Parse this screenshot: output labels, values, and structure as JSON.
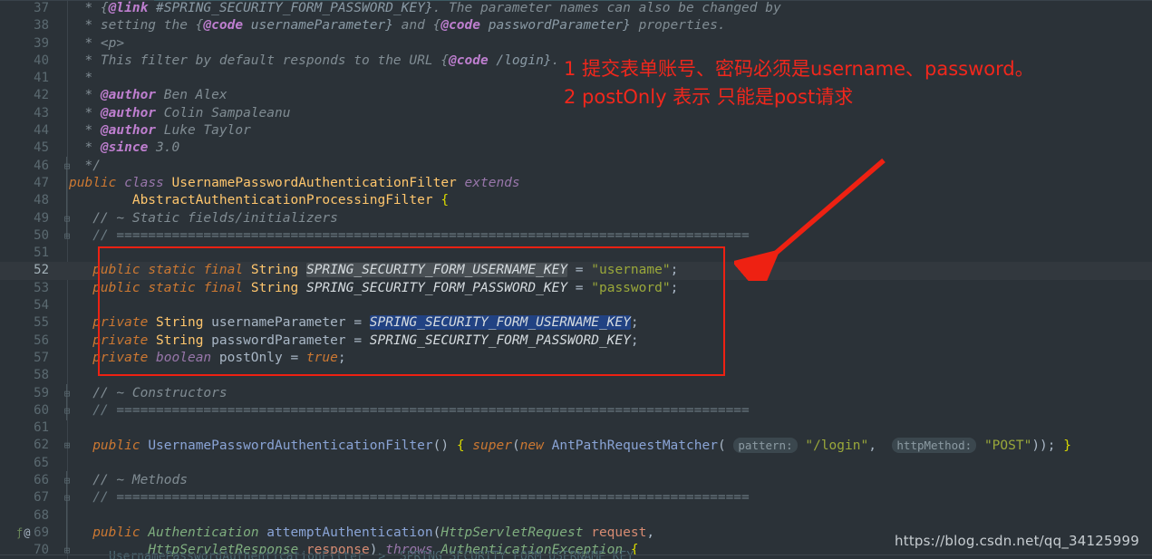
{
  "editor": {
    "theme": "darcula",
    "background": "#2b3238",
    "current_line": 52,
    "watermark": "https://blog.csdn.net/qq_34125999",
    "breadcrumb": "UsernamePasswordAuthenticationFilter  >  SPRING_SECURITY_FORM_USERNAME_KEY"
  },
  "colors": {
    "annotation_red": "#f1271c",
    "box_red": "#ee2112",
    "keyword": "#cc7832",
    "keyword2": "#9876aa",
    "type": "#ffc66d",
    "string": "#9aa83a",
    "comment": "#808c93",
    "javadoc_tag": "#bf7fd0",
    "method": "#8aa4d6",
    "selection_grey": "#4a5055",
    "selection_blue": "#214283"
  },
  "annotations": {
    "note_1": "1 提交表单账号、密码必须是username、password。",
    "note_2": "2 postOnly 表示 只能是post请求"
  },
  "lines": [
    {
      "n": "37",
      "fold": "",
      "marks": ""
    },
    {
      "n": "38",
      "fold": "",
      "marks": ""
    },
    {
      "n": "39",
      "fold": "",
      "marks": ""
    },
    {
      "n": "40",
      "fold": "",
      "marks": ""
    },
    {
      "n": "41",
      "fold": "",
      "marks": ""
    },
    {
      "n": "42",
      "fold": "",
      "marks": ""
    },
    {
      "n": "43",
      "fold": "",
      "marks": ""
    },
    {
      "n": "44",
      "fold": "",
      "marks": ""
    },
    {
      "n": "45",
      "fold": "",
      "marks": ""
    },
    {
      "n": "46",
      "fold": "⊟",
      "marks": ""
    },
    {
      "n": "47",
      "fold": "",
      "marks": ""
    },
    {
      "n": "48",
      "fold": "",
      "marks": ""
    },
    {
      "n": "49",
      "fold": "⊟",
      "marks": ""
    },
    {
      "n": "50",
      "fold": "⊟",
      "marks": ""
    },
    {
      "n": "51",
      "fold": "",
      "marks": ""
    },
    {
      "n": "52",
      "fold": "",
      "marks": ""
    },
    {
      "n": "53",
      "fold": "",
      "marks": ""
    },
    {
      "n": "54",
      "fold": "",
      "marks": ""
    },
    {
      "n": "55",
      "fold": "",
      "marks": ""
    },
    {
      "n": "56",
      "fold": "",
      "marks": ""
    },
    {
      "n": "57",
      "fold": "",
      "marks": ""
    },
    {
      "n": "58",
      "fold": "",
      "marks": ""
    },
    {
      "n": "59",
      "fold": "⊟",
      "marks": ""
    },
    {
      "n": "60",
      "fold": "⊟",
      "marks": ""
    },
    {
      "n": "61",
      "fold": "",
      "marks": ""
    },
    {
      "n": "62",
      "fold": "⊞",
      "marks": ""
    },
    {
      "n": "65",
      "fold": "",
      "marks": ""
    },
    {
      "n": "66",
      "fold": "⊟",
      "marks": ""
    },
    {
      "n": "67",
      "fold": "⊟",
      "marks": ""
    },
    {
      "n": "68",
      "fold": "",
      "marks": ""
    },
    {
      "n": "69",
      "fold": "",
      "marks": "ƒ @"
    },
    {
      "n": "70",
      "fold": "⊟",
      "marks": ""
    }
  ],
  "code_text": {
    "l37": "  * {@link #SPRING_SECURITY_FORM_PASSWORD_KEY}. The parameter names can also be changed by",
    "l38": "  * setting the {@code usernameParameter} and {@code passwordParameter} properties.",
    "l39": "  * <p>",
    "l40": "  * This filter by default responds to the URL {@code /login}.",
    "l41": "  *",
    "l42": "  * @author Ben Alex",
    "l43": "  * @author Colin Sampaleanu",
    "l44": "  * @author Luke Taylor",
    "l45": "  * @since 3.0",
    "l46": "  */",
    "l47": "public class UsernamePasswordAuthenticationFilter extends",
    "l48": "         AbstractAuthenticationProcessingFilter {",
    "l49": "   // ~ Static fields/initializers",
    "l50": "   // ================================================================================",
    "l51": "",
    "l52": "   public static final String SPRING_SECURITY_FORM_USERNAME_KEY = \"username\";",
    "l53": "   public static final String SPRING_SECURITY_FORM_PASSWORD_KEY = \"password\";",
    "l54": "",
    "l55": "   private String usernameParameter = SPRING_SECURITY_FORM_USERNAME_KEY;",
    "l56": "   private String passwordParameter = SPRING_SECURITY_FORM_PASSWORD_KEY;",
    "l57": "   private boolean postOnly = true;",
    "l58": "",
    "l59": "   // ~ Constructors",
    "l60": "   // ================================================================================",
    "l61": "",
    "l62": "   public UsernamePasswordAuthenticationFilter() { super(new AntPathRequestMatcher( pattern: \"/login\",  httpMethod: \"POST\")); }",
    "l65": "",
    "l66": "   // ~ Methods",
    "l67": "   // ================================================================================",
    "l68": "",
    "l69": "   public Authentication attemptAuthentication(HttpServletRequest request,",
    "l70": "            HttpServletResponse response) throws AuthenticationException {"
  },
  "tokens": {
    "link": "{@link",
    "code": "{@code",
    "author": "@author",
    "since": "@since",
    "ben_alex": "Ben Alex",
    "colin": "Colin Sampaleanu",
    "luke": "Luke Taylor",
    "version": "3.0",
    "class_name": "UsernamePasswordAuthenticationFilter",
    "super_class": "AbstractAuthenticationProcessingFilter",
    "username_key": "SPRING_SECURITY_FORM_USERNAME_KEY",
    "password_key": "SPRING_SECURITY_FORM_PASSWORD_KEY",
    "username_value": "\"username\"",
    "password_value": "\"password\"",
    "username_param": "usernameParameter",
    "password_param": "passwordParameter",
    "post_only": "postOnly",
    "true_lit": "true",
    "matcher": "AntPathRequestMatcher",
    "hint_pattern": "pattern:",
    "hint_method": "httpMethod:",
    "login_path": "\"/login\"",
    "post_method": "\"POST\"",
    "method_name": "attemptAuthentication",
    "req_type": "HttpServletRequest",
    "res_type": "HttpServletResponse",
    "req_name": "request",
    "res_name": "response",
    "auth_type": "Authentication",
    "auth_exception": "AuthenticationException",
    "static_fields_cmt": "// ~ Static fields/initializers",
    "constructors_cmt": "// ~ Constructors",
    "methods_cmt": "// ~ Methods",
    "divider": "// ================================================================================"
  }
}
